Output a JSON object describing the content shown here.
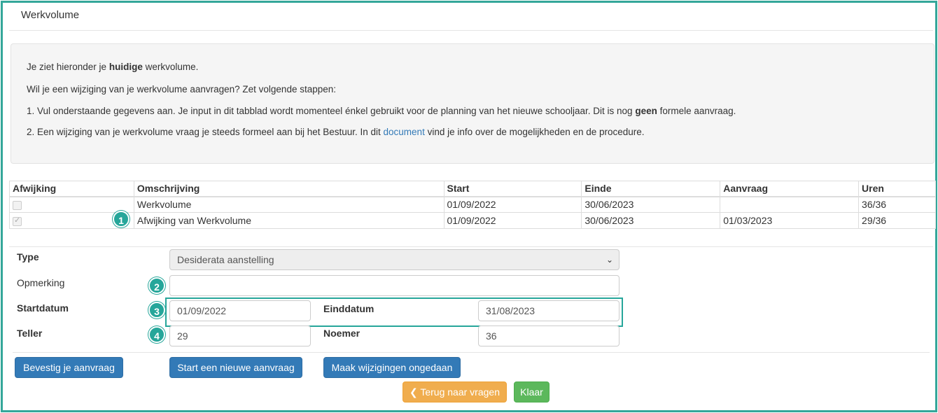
{
  "page": {
    "title": "Werkvolume"
  },
  "info": {
    "line1_pre": "Je ziet hieronder je ",
    "line1_bold": "huidige",
    "line1_post": " werkvolume.",
    "line2": "Wil je een wijziging van je werkvolume aanvragen? Zet volgende stappen:",
    "line3_pre": "1. Vul onderstaande gegevens aan. Je input in dit tabblad wordt momenteel énkel gebruikt voor de planning van het nieuwe schooljaar. Dit is nog ",
    "line3_bold": "geen",
    "line3_post": " formele aanvraag.",
    "line4_pre": "2. Een wijziging van je werkvolume vraag je steeds formeel aan bij het Bestuur. In dit ",
    "line4_link": "document",
    "line4_post": " vind je info over de mogelijkheden en de procedure."
  },
  "table": {
    "headers": [
      "Afwijking",
      "Omschrijving",
      "Start",
      "Einde",
      "Aanvraag",
      "Uren"
    ],
    "rows": [
      {
        "checked": false,
        "omschrijving": "Werkvolume",
        "start": "01/09/2022",
        "einde": "30/06/2023",
        "aanvraag": "",
        "uren": "36/36"
      },
      {
        "checked": true,
        "omschrijving": "Afwijking van Werkvolume",
        "start": "01/09/2022",
        "einde": "30/06/2023",
        "aanvraag": "01/03/2023",
        "uren": "29/36"
      }
    ]
  },
  "form": {
    "type_label": "Type",
    "type_value": "Desiderata aanstelling",
    "opmerking_label": "Opmerking",
    "opmerking_value": "",
    "startdatum_label": "Startdatum",
    "startdatum_value": "01/09/2022",
    "einddatum_label": "Einddatum",
    "einddatum_value": "31/08/2023",
    "teller_label": "Teller",
    "teller_value": "29",
    "noemer_label": "Noemer",
    "noemer_value": "36"
  },
  "badges": [
    "1",
    "2",
    "3",
    "4"
  ],
  "buttons": {
    "bevestig": "Bevestig je aanvraag",
    "nieuwe": "Start een nieuwe aanvraag",
    "ongedaan": "Maak wijzigingen ongedaan",
    "terug": "Terug naar vragen",
    "klaar": "Klaar"
  },
  "icons": {
    "terug": "chevron-left-icon",
    "select": "chevron-down-icon"
  },
  "colors": {
    "accent": "#26a69a",
    "primary": "#337ab7",
    "warning": "#f0ad4e",
    "success": "#5cb85c"
  }
}
